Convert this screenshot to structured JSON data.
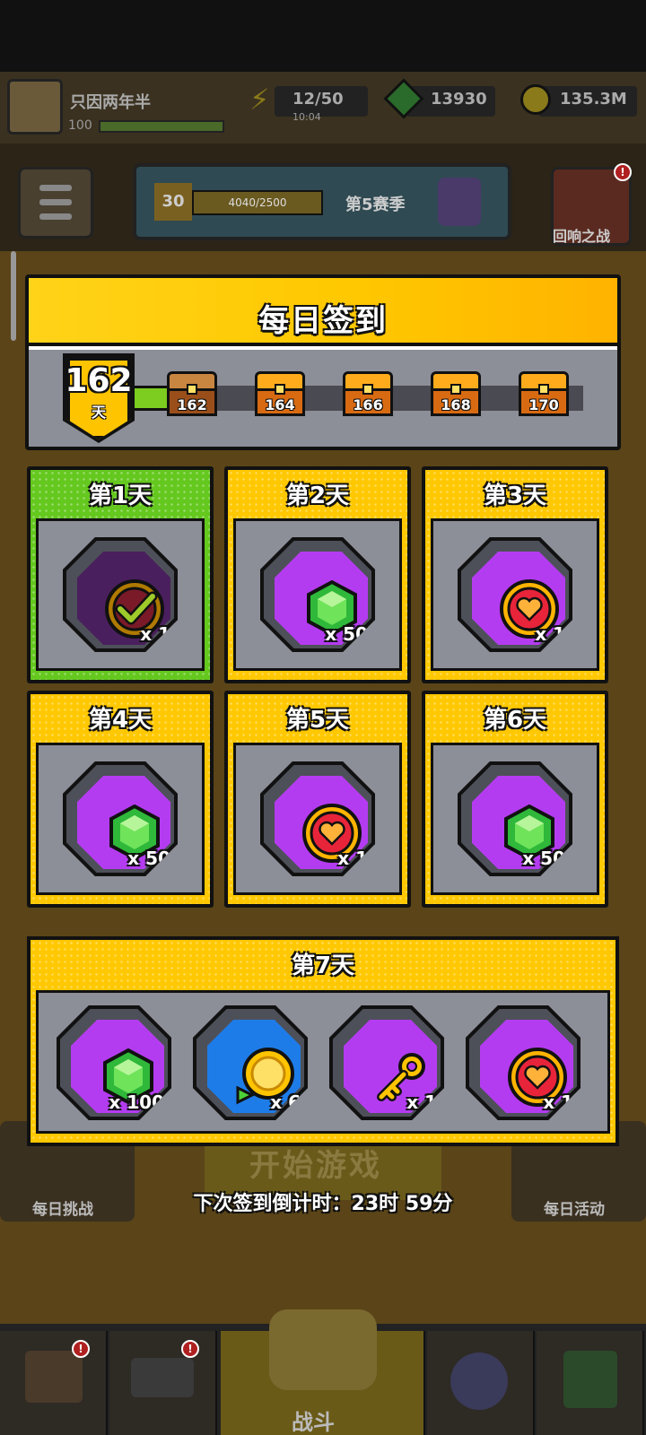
{
  "player": {
    "name": "只因两年半",
    "level": "100"
  },
  "resources": {
    "energy": "12/50",
    "energy_timer": "10:04",
    "gems": "13930",
    "coins": "135.3M"
  },
  "season": {
    "level": "30",
    "progress": "4040/2500",
    "name": "第5赛季"
  },
  "echo_battle": {
    "label": "回响之战",
    "badge": "!"
  },
  "side": {
    "daily_challenge": "每日挑战",
    "daily_event": "每日活动",
    "start_game": "开始游戏"
  },
  "nav": {
    "battle": "战斗",
    "badge": "!"
  },
  "modal": {
    "title": "每日签到",
    "streak": {
      "days": "162",
      "unit": "天"
    },
    "milestones": [
      {
        "day": "162",
        "opened": true
      },
      {
        "day": "164",
        "opened": false
      },
      {
        "day": "166",
        "opened": false
      },
      {
        "day": "168",
        "opened": false
      },
      {
        "day": "170",
        "opened": false
      }
    ],
    "days": [
      {
        "label": "第1天",
        "reward": "claimed-check-icon",
        "qty": "x 1",
        "claimed": true
      },
      {
        "label": "第2天",
        "reward": "gem-icon",
        "qty": "x 50"
      },
      {
        "label": "第3天",
        "reward": "heart-coin-icon",
        "qty": "x 1"
      },
      {
        "label": "第4天",
        "reward": "gem-icon",
        "qty": "x 50"
      },
      {
        "label": "第5天",
        "reward": "heart-coin-icon",
        "qty": "x 1"
      },
      {
        "label": "第6天",
        "reward": "gem-icon",
        "qty": "x 50"
      }
    ],
    "day7": {
      "label": "第7天",
      "rewards": [
        {
          "reward": "gem-icon",
          "qty": "x 100"
        },
        {
          "reward": "gold-coin-icon",
          "qty": "x 6"
        },
        {
          "reward": "key-icon",
          "qty": "x 1"
        },
        {
          "reward": "heart-coin-icon",
          "qty": "x 1"
        }
      ]
    },
    "countdown": "下次签到倒计时：23时 59分"
  },
  "colors": {
    "panel_yellow": "#ffc800",
    "claimed_green": "#64c81e",
    "reward_purple": "#b43cf0",
    "slot_gray": "#8c8e98"
  }
}
